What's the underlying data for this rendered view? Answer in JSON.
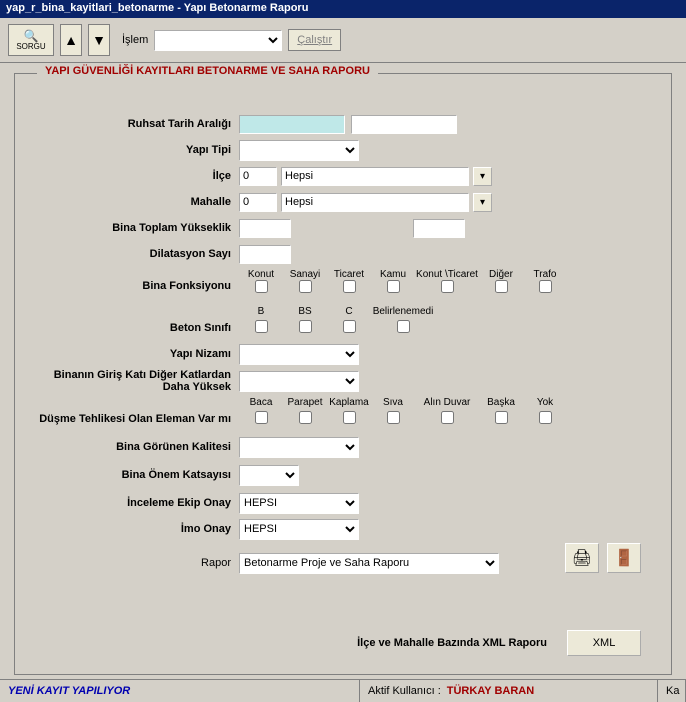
{
  "window": {
    "title": "yap_r_bina_kayitlari_betonarme - Yapı Betonarme Raporu"
  },
  "toolbar": {
    "sorgu_label": "SORGU",
    "islem_label": "İşlem",
    "run_label": "Çalıştır"
  },
  "group": {
    "title": "YAPI GÜVENLİĞİ KAYITLARI BETONARME VE SAHA RAPORU"
  },
  "labels": {
    "ruhsat": "Ruhsat Tarih Aralığı",
    "yapi_tipi": "Yapı Tipi",
    "ilce": "İlçe",
    "mahalle": "Mahalle",
    "bina_yukseklik": "Bina Toplam Yükseklik",
    "dilatasyon": "Dilatasyon Sayı",
    "bina_fonksiyonu": "Bina Fonksiyonu",
    "beton_sinifi": "Beton Sınıfı",
    "yapi_nizami": "Yapı Nizamı",
    "giris_kat": "Binanın Giriş Katı Diğer Katlardan Daha Yüksek",
    "dusme": "Düşme Tehlikesi Olan Eleman Var mı",
    "gorunen_kalite": "Bina Görünen Kalitesi",
    "onem_katsayi": "Bina Önem Katsayısı",
    "inceleme_onay": "İnceleme Ekip Onay",
    "imo_onay": "İmo Onay",
    "rapor": "Rapor",
    "xml_label": "İlçe ve Mahalle Bazında XML Raporu",
    "xml_btn": "XML"
  },
  "values": {
    "ilce_code": "0",
    "ilce_name": "Hepsi",
    "mahalle_code": "0",
    "mahalle_name": "Hepsi",
    "inceleme_onay": "HEPSI",
    "imo_onay": "HEPSI",
    "rapor": "Betonarme Proje ve Saha Raporu"
  },
  "fonksiyon_headers": [
    "Konut",
    "Sanayi",
    "Ticaret",
    "Kamu",
    "Konut \\Ticaret",
    "Diğer",
    "Trafo"
  ],
  "beton_headers": [
    "B",
    "BS",
    "C",
    "Belirlenemedi"
  ],
  "dusme_headers": [
    "Baca",
    "Parapet",
    "Kaplama",
    "Sıva",
    "Alın Duvar",
    "Başka",
    "Yok"
  ],
  "status": {
    "mode": "YENİ KAYIT YAPILIYOR",
    "user_label": "Aktif Kullanıcı :",
    "user_name": "TÜRKAY BARAN",
    "tail": "Ka"
  }
}
